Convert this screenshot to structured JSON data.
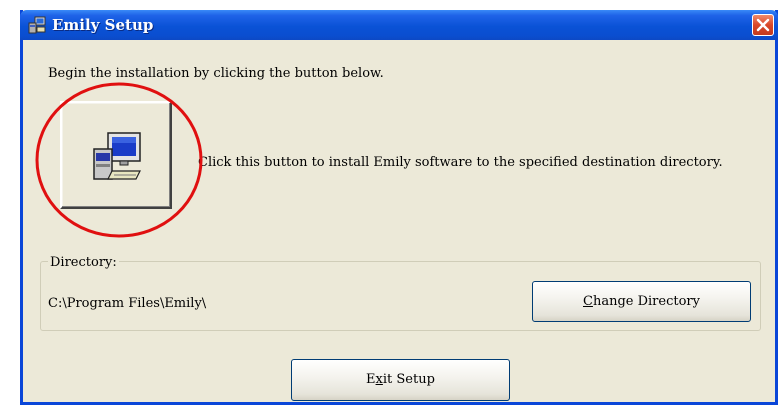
{
  "window": {
    "title": "Emily Setup",
    "colors": {
      "titlebar": "#0a52d6",
      "face": "#ece9d8",
      "highlight": "#e01010"
    }
  },
  "main": {
    "instruction": "Begin the installation by clicking the button below.",
    "install_description": "Click this button to install Emily software to the specified destination directory."
  },
  "directory": {
    "legend": "Directory:",
    "path": "C:\\Program Files\\Emily\\",
    "change_label_prefix": "",
    "change_label_mnemonic": "C",
    "change_label_rest": "hange Directory"
  },
  "footer": {
    "exit_label_prefix": "E",
    "exit_label_mnemonic": "x",
    "exit_label_rest": "it Setup"
  },
  "icons": {
    "app": "setup-app-icon",
    "install": "computer-install-icon",
    "close": "close-icon"
  }
}
